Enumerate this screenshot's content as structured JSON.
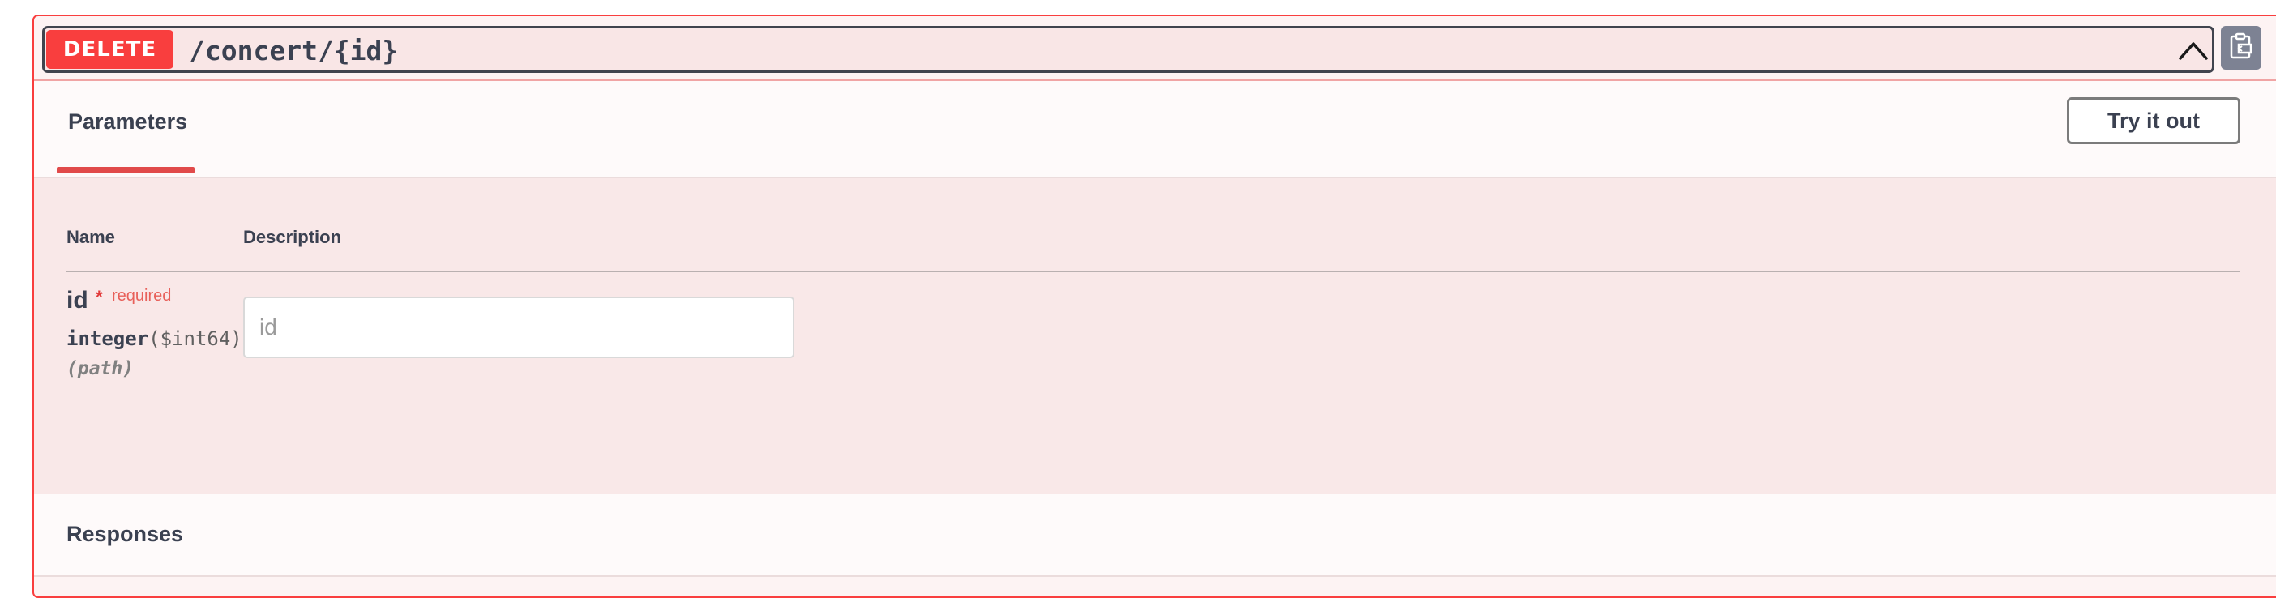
{
  "operation": {
    "method": "DELETE",
    "path": "/concert/{id}",
    "chevron_icon": "chevron-up-icon",
    "copy_icon": "clipboard-copy-icon"
  },
  "parameters_section": {
    "tab_label": "Parameters",
    "try_button": "Try it out",
    "column_name": "Name",
    "column_description": "Description"
  },
  "parameter": {
    "name": "id",
    "required_star": "*",
    "required_label": "required",
    "type": "integer",
    "format": "($int64)",
    "location": "(path)",
    "input_placeholder": "id",
    "input_value": ""
  },
  "responses_section": {
    "title": "Responses"
  },
  "colors": {
    "method_bg": "#f93e3e",
    "block_border": "#f93e3e",
    "block_bg": "#fdf3f3",
    "copy_button_bg": "#7d8293"
  }
}
